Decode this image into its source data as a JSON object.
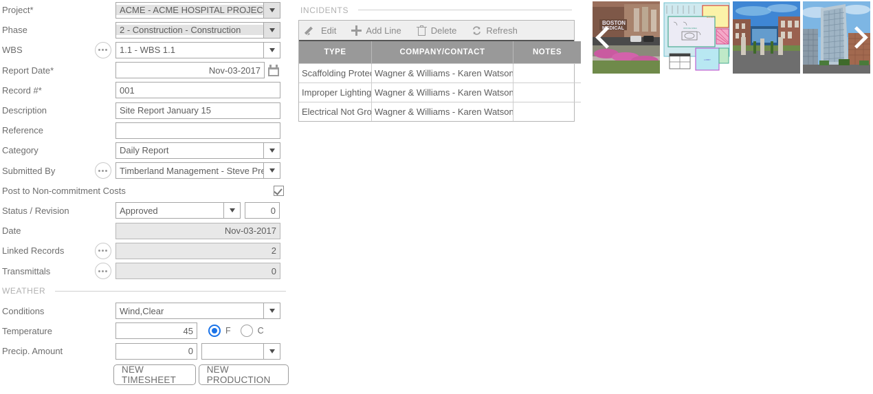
{
  "form": {
    "fields": [
      {
        "label": "Project*",
        "value": "ACME - ACME HOSPITAL PROJECT",
        "type": "select-shaded"
      },
      {
        "label": "Phase",
        "value": "2 - Construction - Construction",
        "type": "select-shaded"
      },
      {
        "label": "WBS",
        "value": "1.1 - WBS 1.1",
        "type": "select"
      },
      {
        "label": "Report Date*",
        "value": "Nov-03-2017",
        "type": "date"
      },
      {
        "label": "Record #*",
        "value": "001",
        "type": "text"
      },
      {
        "label": "Description",
        "value": "Site Report January 15",
        "type": "text"
      },
      {
        "label": "Reference",
        "value": "",
        "type": "text"
      },
      {
        "label": "Category",
        "value": "Daily Report",
        "type": "select"
      },
      {
        "label": "Submitted By",
        "value": "Timberland Management - Steve Pre",
        "type": "select"
      },
      {
        "label": "Post to Non-commitment Costs",
        "value": "",
        "type": "checkbox"
      },
      {
        "label": "Status / Revision",
        "value": "Approved",
        "revision": "0",
        "type": "status"
      },
      {
        "label": "Date",
        "value": "Nov-03-2017",
        "type": "readonly"
      },
      {
        "label": "Linked Records",
        "value": "2",
        "type": "readonly"
      },
      {
        "label": "Transmittals",
        "value": "0",
        "type": "readonly"
      }
    ],
    "weather_section_label": "WEATHER",
    "weather": {
      "conditions_label": "Conditions",
      "conditions_value": "Wind,Clear",
      "temperature_label": "Temperature",
      "temperature_value": "45",
      "unit_f": "F",
      "unit_c": "C",
      "unit_selected": "F",
      "precip_label": "Precip. Amount",
      "precip_value": "0",
      "precip_unit": ""
    },
    "buttons": {
      "new_timesheet": "NEW TIMESHEET",
      "new_production": "NEW PRODUCTION"
    }
  },
  "incidents": {
    "section_label": "INCIDENTS",
    "toolbar": [
      {
        "label": "Edit",
        "icon": "pencil-icon"
      },
      {
        "label": "Add Line",
        "icon": "plus-icon"
      },
      {
        "label": "Delete",
        "icon": "trash-icon"
      },
      {
        "label": "Refresh",
        "icon": "refresh-icon"
      }
    ],
    "columns": [
      "TYPE",
      "COMPANY/CONTACT",
      "NOTES"
    ],
    "rows": [
      {
        "type": "Scaffolding Protection Not Provided",
        "company": "Wagner & Williams - Karen Watson",
        "notes": ""
      },
      {
        "type": "Improper Lighting",
        "company": "Wagner & Williams - Karen Watson",
        "notes": ""
      },
      {
        "type": "Electrical Not Grounded",
        "company": "Wagner & Williams - Karen Watson",
        "notes": ""
      }
    ]
  },
  "carousel": {
    "prev_label": "‹",
    "next_label": "›",
    "thumbnails": [
      {
        "name": "boston-medical-center-sign-photo"
      },
      {
        "name": "floor-plan-drawing"
      },
      {
        "name": "campus-entrance-photo"
      },
      {
        "name": "high-rise-building-photo"
      }
    ]
  },
  "colors": {
    "accent": "#1a73e8",
    "header_gray": "#999999",
    "toolbar_gray": "#efefef"
  }
}
